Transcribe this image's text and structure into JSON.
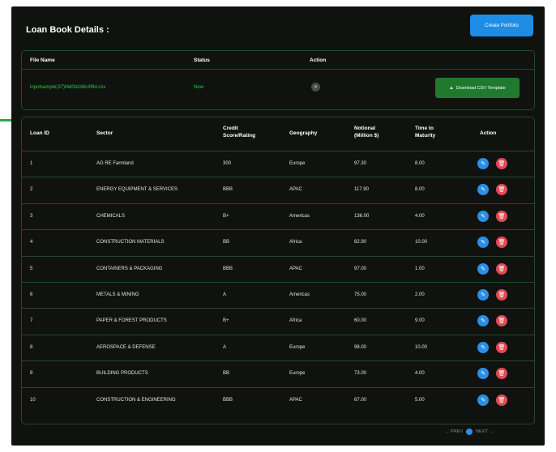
{
  "page": {
    "title": "Loan Book Details :",
    "create_button": "Create Portfolio"
  },
  "files_table": {
    "headers": {
      "file_name": "File Name",
      "status": "Status",
      "action": "Action"
    },
    "row": {
      "file_name": "inputsample(37)f4d0b2d6c4f8d.csv",
      "status": "New"
    },
    "download_button": "Download CSV Template"
  },
  "loan_table": {
    "headers": {
      "loan_id": "Loan ID",
      "sector": "Sector",
      "credit": "Credit Score/Rating",
      "geography": "Geography",
      "notional": "Notional (Million $)",
      "maturity": "Time to Maturity",
      "action": "Action"
    },
    "rows": [
      {
        "id": "1",
        "sector": "AG RE Farmland",
        "credit": "300",
        "geo": "Europe",
        "notional": "97.30",
        "maturity": "8.00"
      },
      {
        "id": "2",
        "sector": "ENERGY EQUIPMENT & SERVICES",
        "credit": "BBB",
        "geo": "APAC",
        "notional": "117.90",
        "maturity": "8.00"
      },
      {
        "id": "3",
        "sector": "CHEMICALS",
        "credit": "B+",
        "geo": "Americas",
        "notional": "136.00",
        "maturity": "4.00"
      },
      {
        "id": "4",
        "sector": "CONSTRUCTION MATERIALS",
        "credit": "BB",
        "geo": "Africa",
        "notional": "82.90",
        "maturity": "10.00"
      },
      {
        "id": "5",
        "sector": "CONTAINERS & PACKAGING",
        "credit": "BBB",
        "geo": "APAC",
        "notional": "97.00",
        "maturity": "1.00"
      },
      {
        "id": "6",
        "sector": "METALS & MINING",
        "credit": "A",
        "geo": "Americas",
        "notional": "75.00",
        "maturity": "2.00"
      },
      {
        "id": "7",
        "sector": "PAPER & FOREST PRODUCTS",
        "credit": "B+",
        "geo": "Africa",
        "notional": "60.00",
        "maturity": "9.00"
      },
      {
        "id": "8",
        "sector": "AEROSPACE & DEFENSE",
        "credit": "A",
        "geo": "Europe",
        "notional": "98.00",
        "maturity": "10.00"
      },
      {
        "id": "9",
        "sector": "BUILDING PRODUCTS",
        "credit": "BB",
        "geo": "Europe",
        "notional": "73.00",
        "maturity": "4.00"
      },
      {
        "id": "10",
        "sector": "CONSTRUCTION & ENGINEERING",
        "credit": "BBB",
        "geo": "APAC",
        "notional": "67.00",
        "maturity": "5.00"
      }
    ]
  },
  "pagination": {
    "prev": "PREV",
    "next": "NEXT",
    "page": "1"
  },
  "colors": {
    "panel": "#0f120f",
    "border": "#24482c",
    "primary": "#1e8de6",
    "success": "#1f7a2e",
    "danger": "#e04a55"
  }
}
